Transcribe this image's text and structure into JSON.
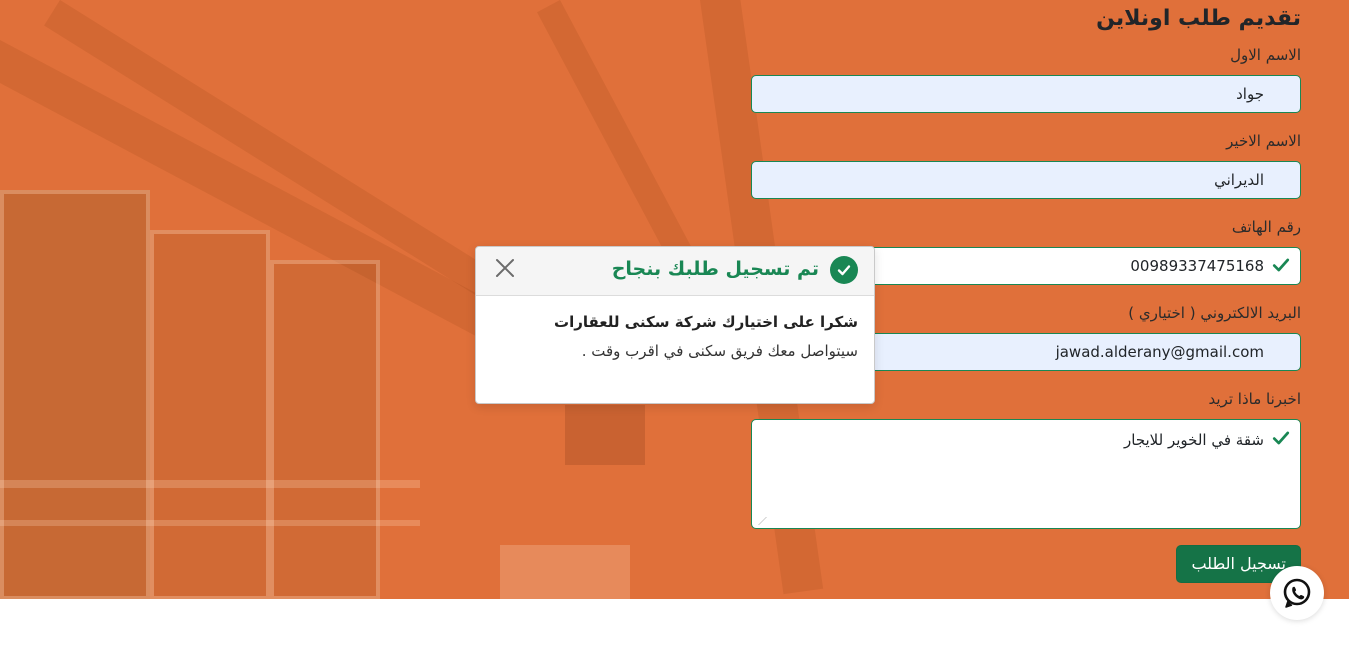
{
  "form": {
    "title": "تقديم طلب اونلاين",
    "first_name": {
      "label": "الاسم الاول",
      "value": "جواد"
    },
    "last_name": {
      "label": "الاسم الاخير",
      "value": "الديراني"
    },
    "phone": {
      "label": "رقم الهاتف",
      "value": "00989337475168"
    },
    "email": {
      "label": "البريد الالكتروني ( اختياري )",
      "value": "jawad.alderany@gmail.com"
    },
    "message": {
      "label": "اخبرنا ماذا تريد",
      "value": "شقة في الخوير للايجار"
    },
    "submit_label": "تسجيل الطلب"
  },
  "toast": {
    "title": "تم تسجيل طلبك بنجاح",
    "line1": "شكرا على اختيارك شركة سكنى للعقارات",
    "line2": "سيتواصل معك فريق سكنى في اقرب وقت ."
  },
  "icons": {
    "check": "check-icon",
    "close": "close-icon",
    "whatsapp": "whatsapp-icon"
  },
  "colors": {
    "hero_overlay": "#e0703a",
    "success": "#198754",
    "button": "#157347",
    "autofill": "#e8f0fe"
  }
}
